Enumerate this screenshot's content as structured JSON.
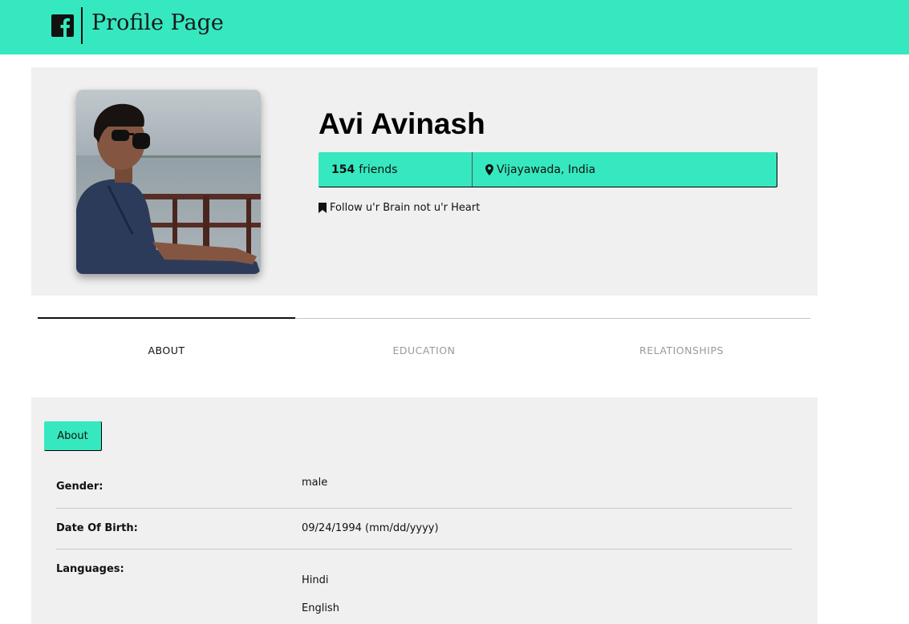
{
  "header": {
    "logo_icon": "facebook-icon",
    "title": "Profile Page",
    "bar_color": "#36e8bf"
  },
  "profile": {
    "name": "Avi Avinash",
    "friends_count": "154",
    "friends_label": "friends",
    "location": "Vijayawada, India",
    "location_icon": "map-marker-icon",
    "motto": "Follow u'r Brain not u'r Heart",
    "motto_icon": "bookmark-icon"
  },
  "tabs": [
    {
      "label": "ABOUT",
      "active": true
    },
    {
      "label": "EDUCATION",
      "active": false
    },
    {
      "label": "RELATIONSHIPS",
      "active": false
    }
  ],
  "about": {
    "button_label": "About",
    "rows": [
      {
        "label": "Gender:",
        "value": "male"
      },
      {
        "label": "Date Of Birth:",
        "value": "09/24/1994 (mm/dd/yyyy)"
      },
      {
        "label": "Languages:",
        "values": [
          "Hindi",
          "English"
        ]
      }
    ]
  },
  "colors": {
    "accent": "#36e8bf",
    "card_bg": "#f0f0f0",
    "inactive_tab": "#9a9a9a"
  }
}
